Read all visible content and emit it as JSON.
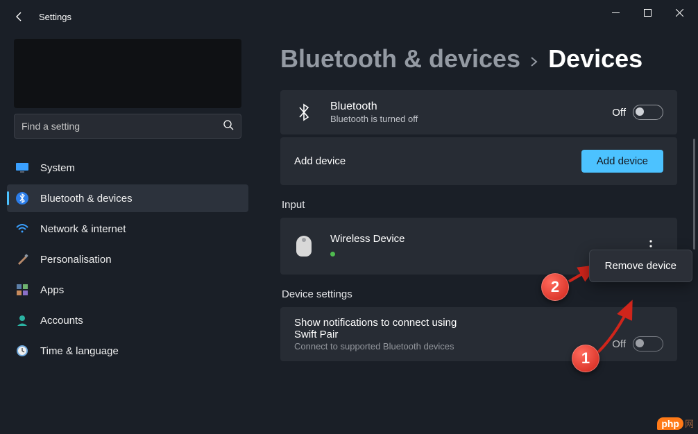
{
  "app": {
    "title": "Settings"
  },
  "search": {
    "placeholder": "Find a setting"
  },
  "sidebar": {
    "items": [
      {
        "label": "System",
        "icon": "monitor"
      },
      {
        "label": "Bluetooth & devices",
        "icon": "bluetooth",
        "active": true
      },
      {
        "label": "Network & internet",
        "icon": "wifi"
      },
      {
        "label": "Personalisation",
        "icon": "brush"
      },
      {
        "label": "Apps",
        "icon": "apps"
      },
      {
        "label": "Accounts",
        "icon": "person"
      },
      {
        "label": "Time & language",
        "icon": "clock"
      }
    ]
  },
  "breadcrumb": {
    "parent": "Bluetooth & devices",
    "current": "Devices"
  },
  "bluetooth_card": {
    "title": "Bluetooth",
    "subtitle": "Bluetooth is turned off",
    "toggle_state": "Off"
  },
  "add_device": {
    "label": "Add device",
    "button": "Add device"
  },
  "sections": {
    "input": "Input",
    "device_settings": "Device settings"
  },
  "input_device": {
    "name": "Wireless Device"
  },
  "swift_pair": {
    "title_line1": "Show notifications to connect using",
    "title_line2": "Swift Pair",
    "subtitle": "Connect to supported Bluetooth devices",
    "toggle_state": "Off"
  },
  "context_menu": {
    "remove": "Remove device"
  },
  "badges": {
    "one": "1",
    "two": "2"
  },
  "watermark": {
    "brand": "php",
    "suffix": "网"
  }
}
